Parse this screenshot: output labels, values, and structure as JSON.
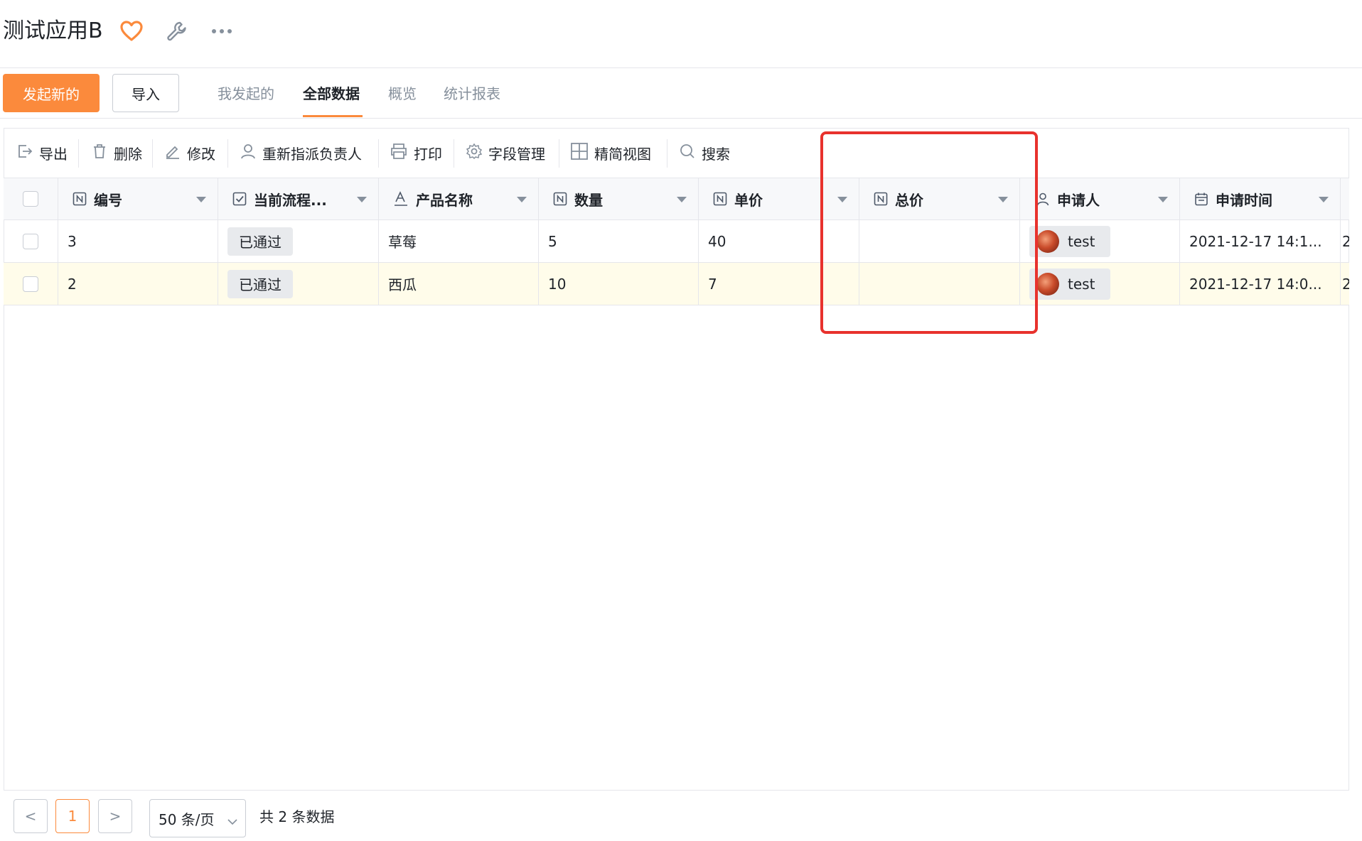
{
  "header": {
    "title": "测试应用B"
  },
  "tabbar": {
    "new_label": "发起新的",
    "import_label": "导入",
    "tabs": [
      {
        "label": "我发起的"
      },
      {
        "label": "全部数据"
      },
      {
        "label": "概览"
      },
      {
        "label": "统计报表"
      }
    ],
    "active_tab": "全部数据"
  },
  "toolbar": {
    "items": [
      {
        "label": "导出",
        "icon": "export-icon"
      },
      {
        "label": "删除",
        "icon": "trash-icon"
      },
      {
        "label": "修改",
        "icon": "edit-icon"
      },
      {
        "label": "重新指派负责人",
        "icon": "user-icon"
      },
      {
        "label": "打印",
        "icon": "printer-icon"
      },
      {
        "label": "字段管理",
        "icon": "gear-icon"
      },
      {
        "label": "精简视图",
        "icon": "grid-icon"
      },
      {
        "label": "搜索",
        "icon": "search-icon"
      }
    ]
  },
  "table": {
    "columns": [
      {
        "label": "编号",
        "icon": "number-field-icon"
      },
      {
        "label": "当前流程...",
        "icon": "checkbox-field-icon"
      },
      {
        "label": "产品名称",
        "icon": "text-field-icon"
      },
      {
        "label": "数量",
        "icon": "number-field-icon"
      },
      {
        "label": "单价",
        "icon": "number-field-icon"
      },
      {
        "label": "总价",
        "icon": "number-field-icon"
      },
      {
        "label": "申请人",
        "icon": "user-field-icon"
      },
      {
        "label": "申请时间",
        "icon": "calendar-field-icon"
      }
    ],
    "rows": [
      {
        "id": "3",
        "status": "已通过",
        "product": "草莓",
        "qty": "5",
        "price": "40",
        "total": "",
        "applicant": "test",
        "time": "2021-12-17 14:1...",
        "overflow": "2"
      },
      {
        "id": "2",
        "status": "已通过",
        "product": "西瓜",
        "qty": "10",
        "price": "7",
        "total": "",
        "applicant": "test",
        "time": "2021-12-17 14:0...",
        "overflow": "2"
      }
    ]
  },
  "footer": {
    "prev": "<",
    "page": "1",
    "next": ">",
    "page_size": "50 条/页",
    "total": "共 2 条数据"
  },
  "colors": {
    "accent": "#fb8a3c",
    "highlight": "#e8322d",
    "row_alt": "#fffcea"
  }
}
